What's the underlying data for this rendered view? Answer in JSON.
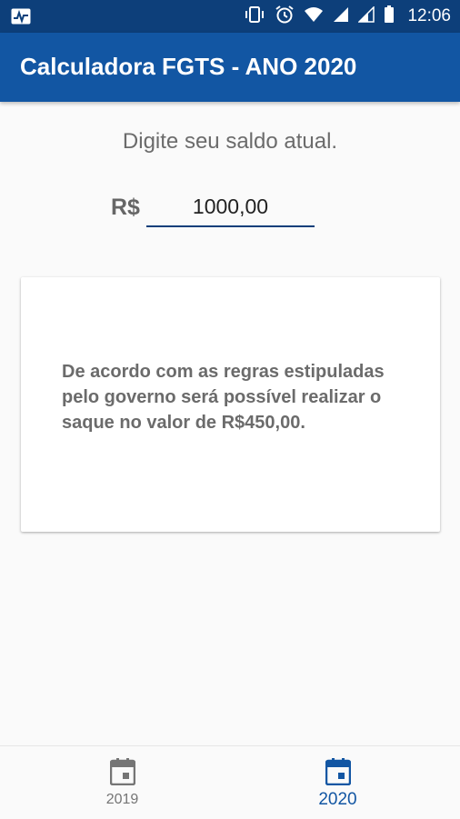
{
  "status_bar": {
    "time": "12:06",
    "icons": [
      "activity-icon",
      "vibrate-icon",
      "alarm-icon",
      "wifi-icon",
      "signal-icon",
      "signal-icon",
      "battery-icon"
    ]
  },
  "app_bar": {
    "title": "Calculadora FGTS - ANO 2020"
  },
  "form": {
    "prompt": "Digite seu saldo atual.",
    "currency_label": "R$",
    "amount_value": "1000,00"
  },
  "result_card": {
    "message": "De acordo com as regras estipuladas pelo governo será possível realizar o saque no valor de R$450,00."
  },
  "bottom_nav": {
    "items": [
      {
        "label": "2019",
        "icon": "calendar-icon",
        "active": false
      },
      {
        "label": "2020",
        "icon": "calendar-icon",
        "active": true
      }
    ]
  },
  "colors": {
    "status_bar": "#0d3f7a",
    "app_bar": "#1256a3",
    "active_accent": "#1256a3",
    "inactive": "#757575"
  }
}
